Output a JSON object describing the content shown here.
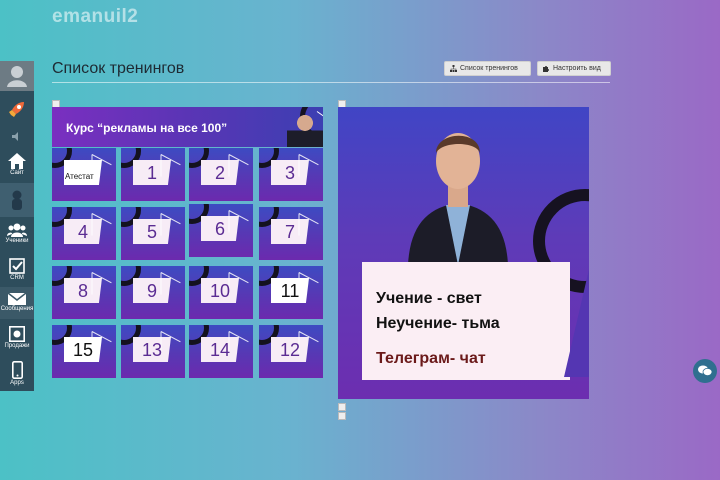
{
  "brand": "emanuil2",
  "sidebar": {
    "items": [
      {
        "name": "avatar",
        "label": ""
      },
      {
        "name": "rocket",
        "label": ""
      },
      {
        "name": "sound",
        "label": ""
      },
      {
        "name": "site",
        "label": "Сайт"
      },
      {
        "name": "user",
        "label": ""
      },
      {
        "name": "students",
        "label": "Ученики"
      },
      {
        "name": "crm",
        "label": "CRM"
      },
      {
        "name": "messages",
        "label": "Сообщения"
      },
      {
        "name": "sales",
        "label": "Продажи"
      },
      {
        "name": "apps",
        "label": "Apps"
      }
    ]
  },
  "header": {
    "title": "Список тренингов",
    "btn_list": "Список тренингов",
    "btn_view": "Настроить вид"
  },
  "banner": {
    "text": "Курс “рекламы на все 100”"
  },
  "tiles": [
    {
      "label": "Атестат"
    },
    {
      "label": "1"
    },
    {
      "label": "2"
    },
    {
      "label": "3"
    },
    {
      "label": "4"
    },
    {
      "label": "5"
    },
    {
      "label": "6"
    },
    {
      "label": "7"
    },
    {
      "label": "8"
    },
    {
      "label": "9"
    },
    {
      "label": "10"
    },
    {
      "label": "11"
    },
    {
      "label": "15"
    },
    {
      "label": "13"
    },
    {
      "label": "14"
    },
    {
      "label": "12"
    }
  ],
  "poster": {
    "line1": "Учение - свет",
    "line2": "Неучение- тьма",
    "line3": "Телеграм- чат"
  },
  "colors": {
    "sidebar": "#2e4d5c",
    "accent_purple": "#6c2aae",
    "accent_blue": "#3d4bc2"
  }
}
